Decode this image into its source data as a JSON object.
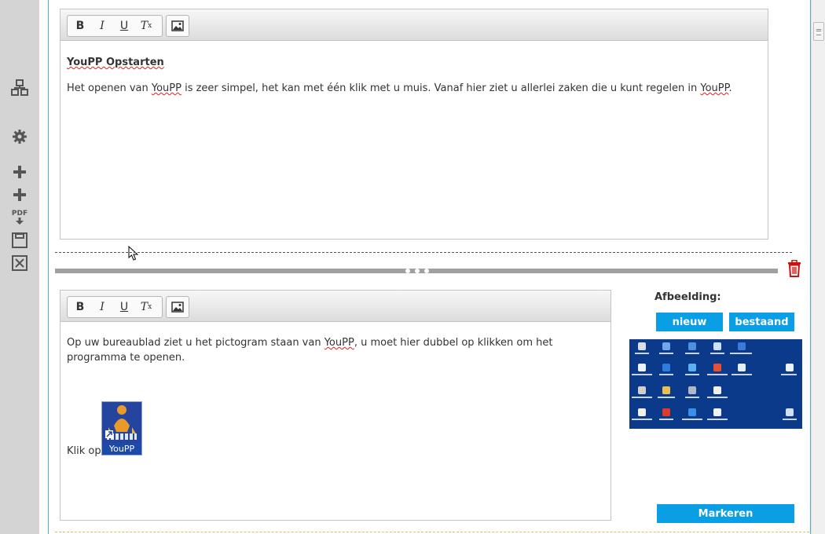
{
  "sidebar": {
    "icons": [
      {
        "name": "structure-icon"
      },
      {
        "name": "gear-icon"
      },
      {
        "name": "add-icon"
      },
      {
        "name": "add-icon"
      },
      {
        "name": "pdf-download-icon",
        "label": "PDF"
      },
      {
        "name": "save-icon"
      },
      {
        "name": "close-icon"
      }
    ]
  },
  "editor1": {
    "toolbar": {
      "bold": "B",
      "italic": "I",
      "underline": "U",
      "clear": "T",
      "clear_sub": "x"
    },
    "heading": "YouPP Opstarten",
    "paragraph_parts": [
      "Het openen van ",
      "YouPP",
      " is zeer simpel, het kan met één klik met u muis. Vanaf hier ziet u allerlei zaken die u kunt regelen in ",
      "YouPP",
      "."
    ]
  },
  "editor2": {
    "toolbar": {
      "bold": "B",
      "italic": "I",
      "underline": "U",
      "clear": "T",
      "clear_sub": "x"
    },
    "paragraph_parts": [
      "Op uw bureaublad ziet u het pictogram staan van ",
      "YouPP",
      ", u moet hier dubbel op klikken om het programma te openen."
    ],
    "klik_label": "Klik op:",
    "icon_caption": "YouPP"
  },
  "right_panel": {
    "label": "Afbeelding:",
    "new_button": "nieuw",
    "existing_button": "bestaand",
    "mark_button": "Markeren"
  },
  "colors": {
    "accent": "#0a9ee4",
    "trash": "#cc1111",
    "frame": "#4ab0e0"
  }
}
